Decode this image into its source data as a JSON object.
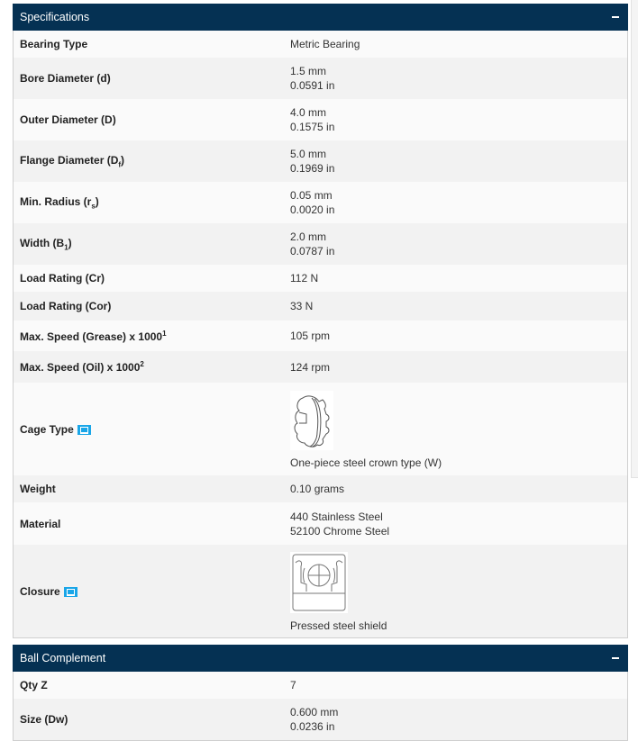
{
  "specifications": {
    "title": "Specifications",
    "toggle": "collapse",
    "rows": [
      {
        "label": "Bearing Type",
        "values": [
          "Metric Bearing"
        ]
      },
      {
        "label": "Bore Diameter (d)",
        "values": [
          "1.5 mm",
          "0.0591 in"
        ]
      },
      {
        "label": "Outer Diameter (D)",
        "values": [
          "4.0 mm",
          "0.1575 in"
        ]
      },
      {
        "label_main": "Flange Diameter (D",
        "label_sub": "f",
        "label_end": ")",
        "values": [
          "5.0 mm",
          "0.1969 in"
        ]
      },
      {
        "label_main": "Min. Radius (r",
        "label_sub": "s",
        "label_end": ")",
        "values": [
          "0.05 mm",
          "0.0020 in"
        ]
      },
      {
        "label_main": "Width (B",
        "label_sub": "1",
        "label_end": ")",
        "values": [
          "2.0 mm",
          "0.0787 in"
        ]
      },
      {
        "label": "Load Rating (Cr)",
        "values": [
          "112 N"
        ]
      },
      {
        "label": "Load Rating (Cor)",
        "values": [
          "33 N"
        ]
      },
      {
        "label_main": "Max. Speed (Grease) x 1000",
        "label_sup": "1",
        "values": [
          "105 rpm"
        ]
      },
      {
        "label_main": "Max. Speed (Oil) x 1000",
        "label_sup": "2",
        "values": [
          "124 rpm"
        ]
      },
      {
        "label": "Cage Type",
        "icon": "image-icon",
        "figure": "crown-cage-drawing",
        "values": [
          "One-piece steel crown type (W)"
        ]
      },
      {
        "label": "Weight",
        "values": [
          "0.10 grams"
        ]
      },
      {
        "label": "Material",
        "values": [
          "440 Stainless Steel",
          "52100 Chrome Steel"
        ]
      },
      {
        "label": "Closure",
        "icon": "image-icon",
        "figure": "shield-cross-section-drawing",
        "values": [
          "Pressed steel shield"
        ]
      }
    ]
  },
  "ball_complement": {
    "title": "Ball Complement",
    "toggle": "collapse",
    "rows": [
      {
        "label": "Qty Z",
        "values": [
          "7"
        ]
      },
      {
        "label": "Size (Dw)",
        "values": [
          "0.600 mm",
          "0.0236 in"
        ]
      }
    ]
  }
}
